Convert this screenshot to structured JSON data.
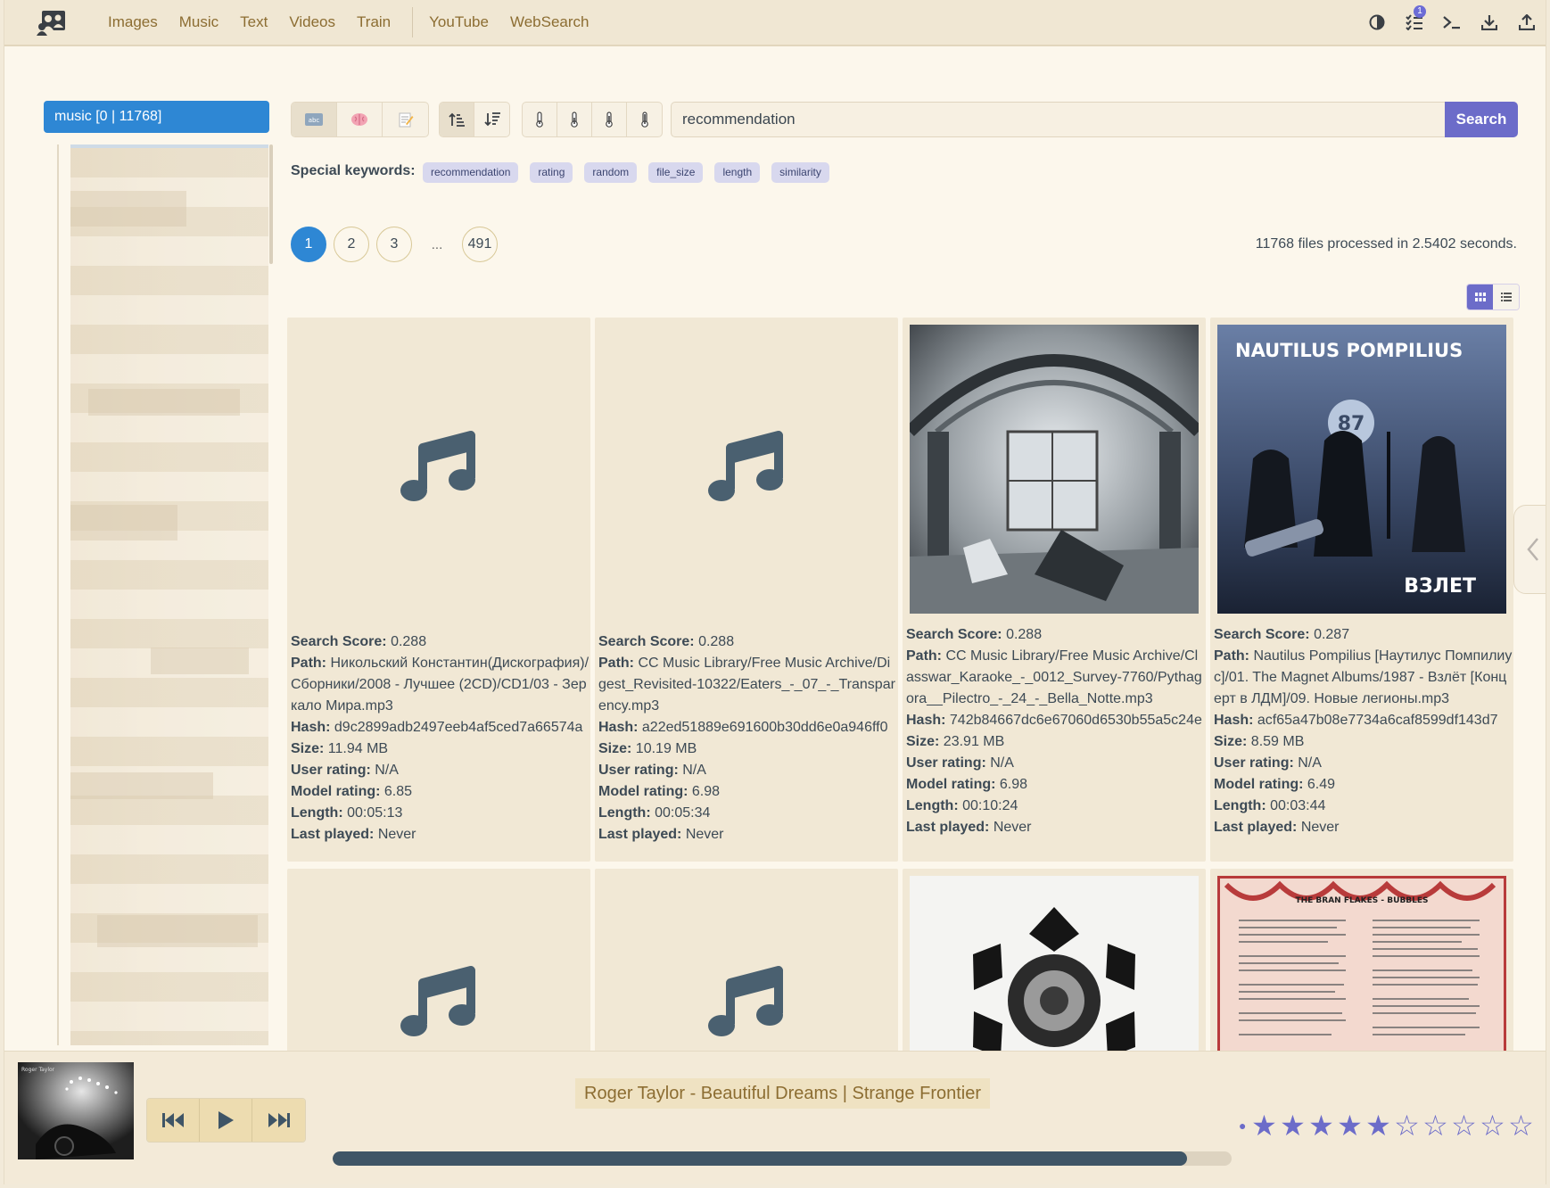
{
  "nav": {
    "links": [
      "Images",
      "Music",
      "Text",
      "Videos",
      "Train",
      "YouTube",
      "WebSearch"
    ],
    "badge_count": "1",
    "icons": [
      "users-logo-icon",
      "theme-toggle-icon",
      "task-list-icon",
      "terminal-icon",
      "download-icon",
      "upload-icon"
    ]
  },
  "sidebar": {
    "folder_label": "music [0 | 11768]"
  },
  "toolbar": {
    "search_value": "recommendation",
    "search_button": "Search",
    "mode_buttons": [
      "text-mode",
      "semantic-mode",
      "edit-mode"
    ],
    "sort_buttons": [
      "sort-ascending",
      "sort-descending"
    ],
    "temperature_buttons": [
      "temp-1",
      "temp-2",
      "temp-3",
      "temp-4"
    ]
  },
  "keywords": {
    "label": "Special keywords:",
    "tags": [
      "recommendation",
      "rating",
      "random",
      "file_size",
      "length",
      "similarity"
    ]
  },
  "pagination": {
    "pages": [
      "1",
      "2",
      "3"
    ],
    "ellipsis": "...",
    "last": "491",
    "current": "1"
  },
  "stats": "11768 files processed in 2.5402 seconds.",
  "labels": {
    "score": "Search Score:",
    "path": "Path:",
    "hash": "Hash:",
    "size": "Size:",
    "user_rating": "User rating:",
    "model_rating": "Model rating:",
    "length": "Length:",
    "last_played": "Last played:"
  },
  "cards": [
    {
      "thumb": "music-note",
      "score": "0.288",
      "path": "Никольский Константин(Дискография)/Сборники/2008 - Лучшее (2CD)/CD1/03 - Зеркало Мира.mp3",
      "hash": "d9c2899adb2497eeb4af5ced7a66574a",
      "size": "11.94 MB",
      "user_rating": "N/A",
      "model_rating": "6.85",
      "length": "00:05:13",
      "last_played": "Never"
    },
    {
      "thumb": "music-note",
      "score": "0.288",
      "path": "CC Music Library/Free Music Archive/Digest_Revisited-10322/Eaters_-_07_-_Transparency.mp3",
      "hash": "a22ed51889e691600b30dd6e0a946ff0",
      "size": "10.19 MB",
      "user_rating": "N/A",
      "model_rating": "6.98",
      "length": "00:05:34",
      "last_played": "Never"
    },
    {
      "thumb": "ruined-hall",
      "score": "0.288",
      "path": "CC Music Library/Free Music Archive/Classwar_Karaoke_-_0012_Survey-7760/Pythagora__Pilectro_-_24_-_Bella_Notte.mp3",
      "hash": "742b84667dc6e67060d6530b55a5c24e",
      "size": "23.91 MB",
      "user_rating": "N/A",
      "model_rating": "6.98",
      "length": "00:10:24",
      "last_played": "Never"
    },
    {
      "thumb": "nautilus-cover",
      "cover_title": "NAUTILUS POMPILIUS",
      "cover_subtitle": "ВЗЛЕТ",
      "score": "0.287",
      "path": "Nautilus Pompilius [Наутилус Помпилиус]/01. The Magnet Albums/1987 - Взлёт [Концерт в ЛДМ]/09. Новые легионы.mp3",
      "hash": "acf65a47b08e7734a6caf8599df143d7",
      "size": "8.59 MB",
      "user_rating": "N/A",
      "model_rating": "6.49",
      "length": "00:03:44",
      "last_played": "Never"
    },
    {
      "thumb": "music-note"
    },
    {
      "thumb": "music-note"
    },
    {
      "thumb": "snowflake-art"
    },
    {
      "thumb": "bran-flakes-cover",
      "cover_title": "THE BRAN FLAKES - BUBBLES"
    }
  ],
  "player": {
    "track": "Roger Taylor - Beautiful Dreams | Strange Frontier",
    "progress": 0.95,
    "rating": 5,
    "rating_max": 10
  },
  "colors": {
    "accent": "#6c6cc9",
    "primary": "#2e87d4",
    "link": "#8c6d32",
    "background": "#fcf7ec"
  }
}
